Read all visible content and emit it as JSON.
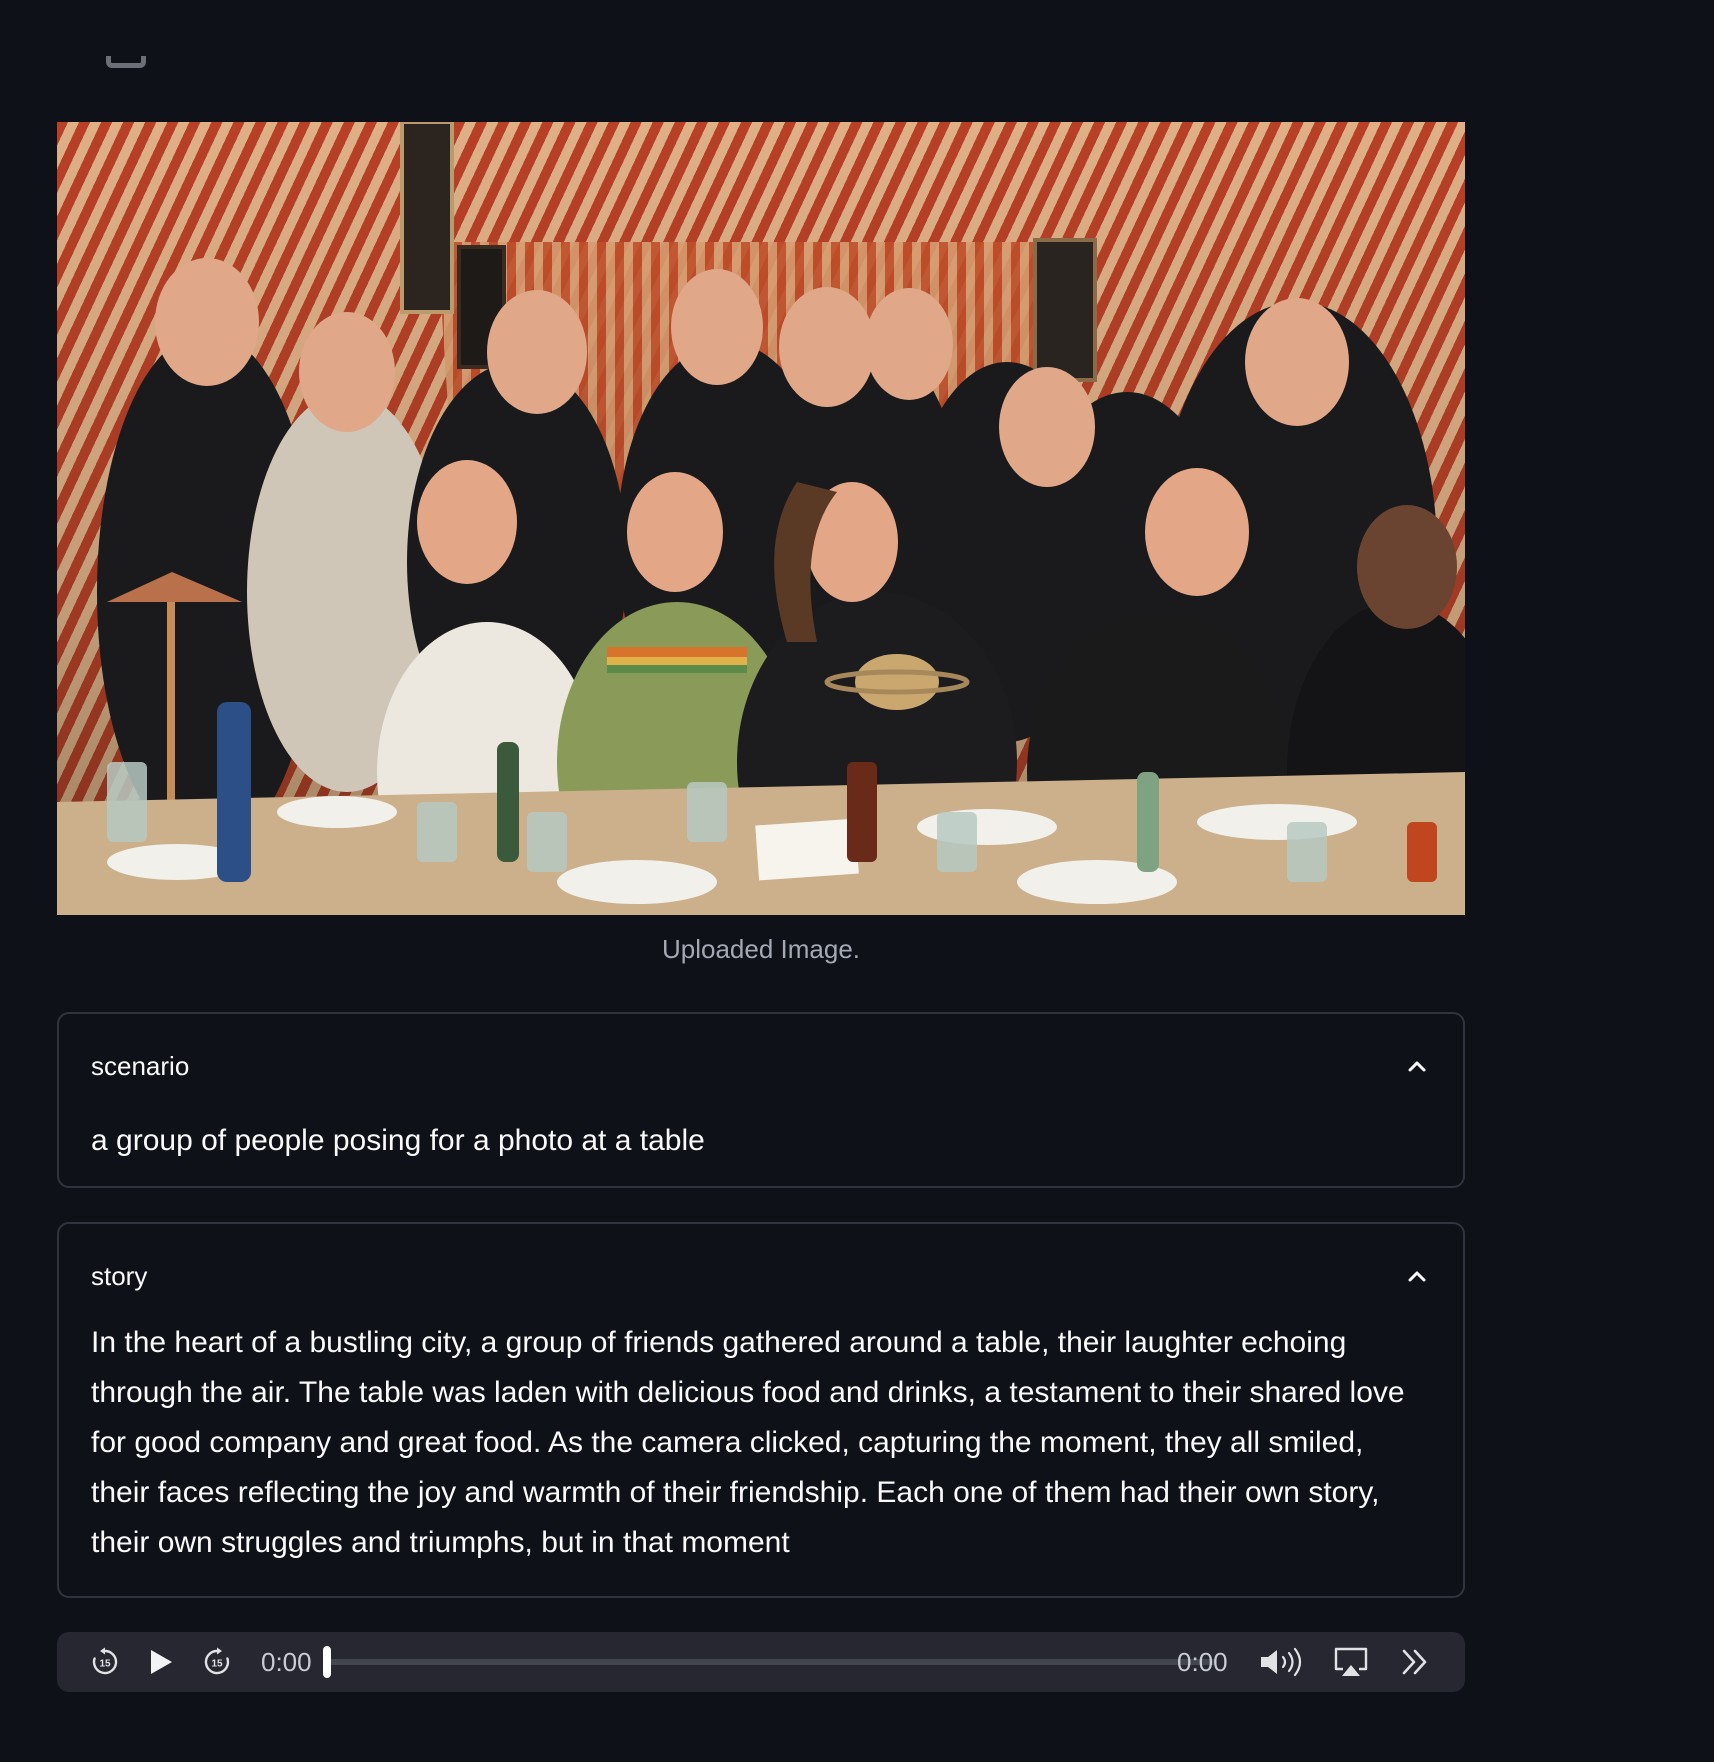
{
  "image": {
    "caption": "Uploaded Image."
  },
  "scenario": {
    "label": "scenario",
    "text": "a group of people posing for a photo at a table"
  },
  "story": {
    "label": "story",
    "text": "In the heart of a bustling city, a group of friends gathered around a table, their laughter echoing through the air. The table was laden with delicious food and drinks, a testament to their shared love for good company and great food. As the camera clicked, capturing the moment, they all smiled, their faces reflecting the joy and warmth of their friendship. Each one of them had their own story, their own struggles and triumphs, but in that moment"
  },
  "audio": {
    "current_time": "0:00",
    "duration": "0:00",
    "progress": 0,
    "skip_seconds": "15"
  },
  "colors": {
    "background": "#0e1117",
    "border": "#31333f",
    "player": "#262730",
    "text": "#fafafa",
    "muted_text": "#a3a8b4"
  }
}
